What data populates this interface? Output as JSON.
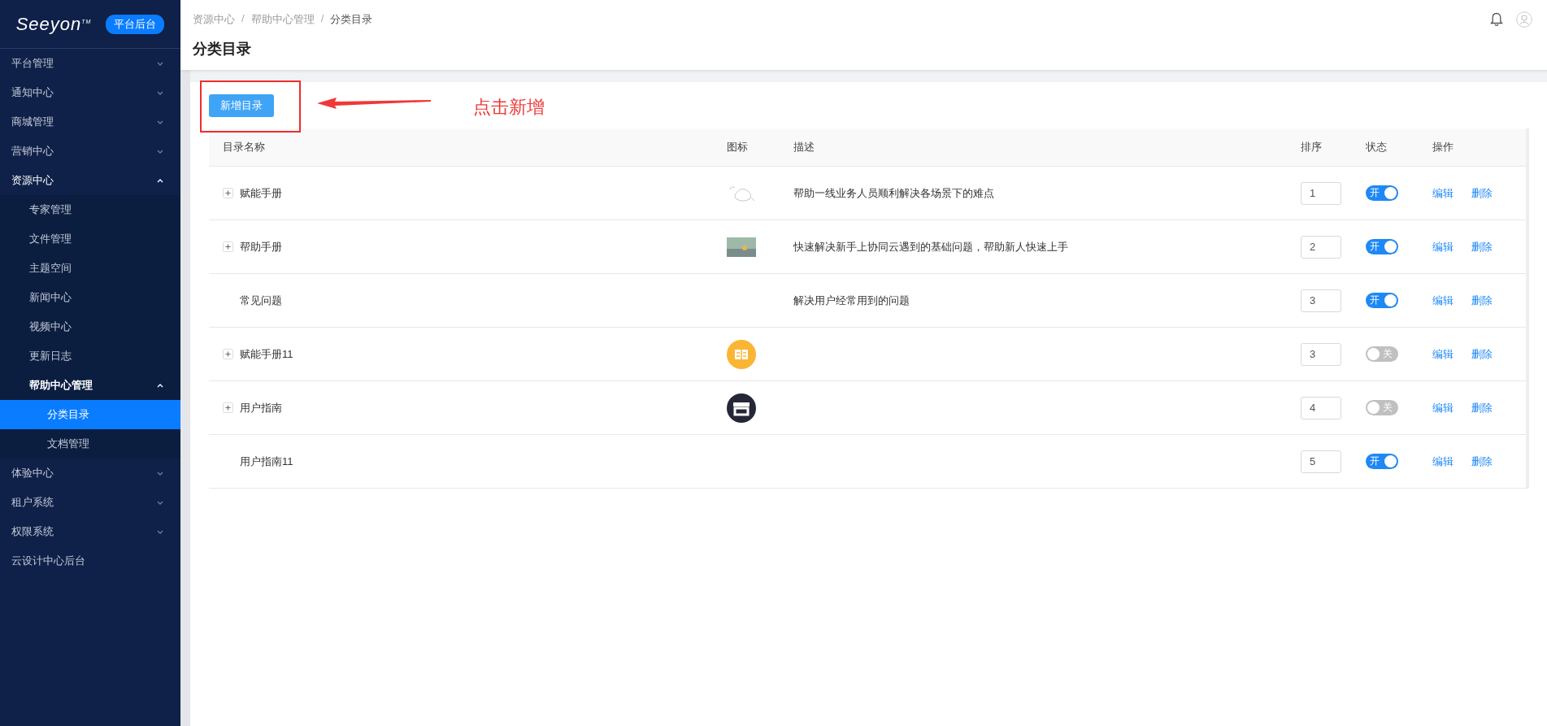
{
  "sidebar": {
    "logo": "Seeyon$^{TM}$",
    "badge": "平台后台",
    "items": [
      {
        "label": "平台管理",
        "expanded": false
      },
      {
        "label": "通知中心",
        "expanded": false
      },
      {
        "label": "商城管理",
        "expanded": false
      },
      {
        "label": "营销中心",
        "expanded": false
      },
      {
        "label": "资源中心",
        "expanded": true,
        "children": [
          {
            "label": "专家管理"
          },
          {
            "label": "文件管理"
          },
          {
            "label": "主题空间"
          },
          {
            "label": "新闻中心"
          },
          {
            "label": "视频中心"
          },
          {
            "label": "更新日志"
          },
          {
            "label": "帮助中心管理",
            "expanded": true,
            "children": [
              {
                "label": "分类目录",
                "selected": true
              },
              {
                "label": "文档管理",
                "selected": false
              }
            ]
          }
        ]
      },
      {
        "label": "体验中心",
        "expanded": false
      },
      {
        "label": "租户系统",
        "expanded": false
      },
      {
        "label": "权限系统",
        "expanded": false
      },
      {
        "label": "云设计中心后台"
      }
    ]
  },
  "breadcrumb": [
    "资源中心",
    "帮助中心管理",
    "分类目录"
  ],
  "breadcrumb_separator": "/",
  "page_title": "分类目录",
  "add_button": "新增目录",
  "annotation": {
    "text": "点击新增"
  },
  "table": {
    "columns": [
      "目录名称",
      "图标",
      "描述",
      "排序",
      "状态",
      "操作"
    ],
    "rows": [
      {
        "name": "赋能手册",
        "expandable": true,
        "icon": {
          "kind": "sketch"
        },
        "description": "帮助一线业务人员顺利解决各场景下的难点",
        "sort": "1",
        "on": true,
        "switch_label": "开",
        "actions": [
          "编辑",
          "删除"
        ]
      },
      {
        "name": "帮助手册",
        "expandable": true,
        "icon": {
          "kind": "photo"
        },
        "description": "快速解决新手上协同云遇到的基础问题，帮助新人快速上手",
        "sort": "2",
        "on": true,
        "switch_label": "开",
        "actions": [
          "编辑",
          "删除"
        ]
      },
      {
        "name": "常见问题",
        "expandable": false,
        "description": "解决用户经常用到的问题",
        "sort": "3",
        "on": true,
        "switch_label": "开",
        "actions": [
          "编辑",
          "删除"
        ]
      },
      {
        "name": "赋能手册11",
        "expandable": true,
        "icon": {
          "kind": "book"
        },
        "sort": "3",
        "on": false,
        "switch_label": "关",
        "actions": [
          "编辑",
          "删除"
        ]
      },
      {
        "name": "用户指南",
        "expandable": true,
        "icon": {
          "kind": "store"
        },
        "sort": "4",
        "on": false,
        "switch_label": "关",
        "actions": [
          "编辑",
          "删除"
        ]
      },
      {
        "name": "用户指南11",
        "expandable": false,
        "sort": "5",
        "on": true,
        "switch_label": "开",
        "actions": [
          "编辑",
          "删除"
        ]
      }
    ]
  }
}
